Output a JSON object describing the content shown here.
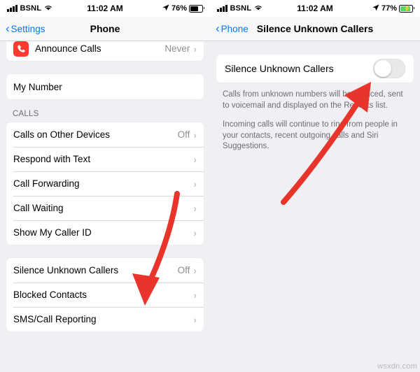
{
  "left": {
    "status": {
      "carrier": "BSNL",
      "time": "11:02 AM",
      "battery_pct": "76%",
      "signal_icon": "signal-bars-icon",
      "wifi_icon": "wifi-icon",
      "location_icon": "location-arrow-icon",
      "battery_icon": "battery-icon"
    },
    "nav": {
      "back_label": "Settings",
      "title": "Phone",
      "back_icon": "chevron-left-icon"
    },
    "rows_top": [
      {
        "label": "Announce Calls",
        "value": "Never",
        "icon": "phone-announce-icon",
        "chevron": "›"
      }
    ],
    "my_number": {
      "label": "My Number",
      "value": "",
      "chevron": ""
    },
    "calls_header": "CALLS",
    "calls_rows": [
      {
        "label": "Calls on Other Devices",
        "value": "Off",
        "chevron": "›"
      },
      {
        "label": "Respond with Text",
        "value": "",
        "chevron": "›"
      },
      {
        "label": "Call Forwarding",
        "value": "",
        "chevron": "›"
      },
      {
        "label": "Call Waiting",
        "value": "",
        "chevron": "›"
      },
      {
        "label": "Show My Caller ID",
        "value": "",
        "chevron": "›"
      }
    ],
    "bottom_rows": [
      {
        "label": "Silence Unknown Callers",
        "value": "Off",
        "chevron": "›"
      },
      {
        "label": "Blocked Contacts",
        "value": "",
        "chevron": "›"
      },
      {
        "label": "SMS/Call Reporting",
        "value": "",
        "chevron": "›"
      }
    ]
  },
  "right": {
    "status": {
      "carrier": "BSNL",
      "time": "11:02 AM",
      "battery_pct": "77%",
      "signal_icon": "signal-bars-icon",
      "wifi_icon": "wifi-icon",
      "location_icon": "location-arrow-icon",
      "battery_icon": "battery-charging-icon"
    },
    "nav": {
      "back_label": "Phone",
      "title": "Silence Unknown Callers",
      "back_icon": "chevron-left-icon"
    },
    "toggle": {
      "label": "Silence Unknown Callers",
      "state": "off",
      "state_label": "Off"
    },
    "footnotes": [
      "Calls from unknown numbers will be silenced, sent to voicemail and displayed on the Recents list.",
      "Incoming calls will continue to ring from people in your contacts, recent outgoing calls and Siri Suggestions."
    ]
  },
  "annotations": {
    "arrow_color": "#e8342a",
    "left_arrow_name": "red-arrow-pointing-to-silence-unknown-callers",
    "right_arrow_name": "red-arrow-pointing-to-toggle"
  },
  "watermark": "wsxdn.com"
}
